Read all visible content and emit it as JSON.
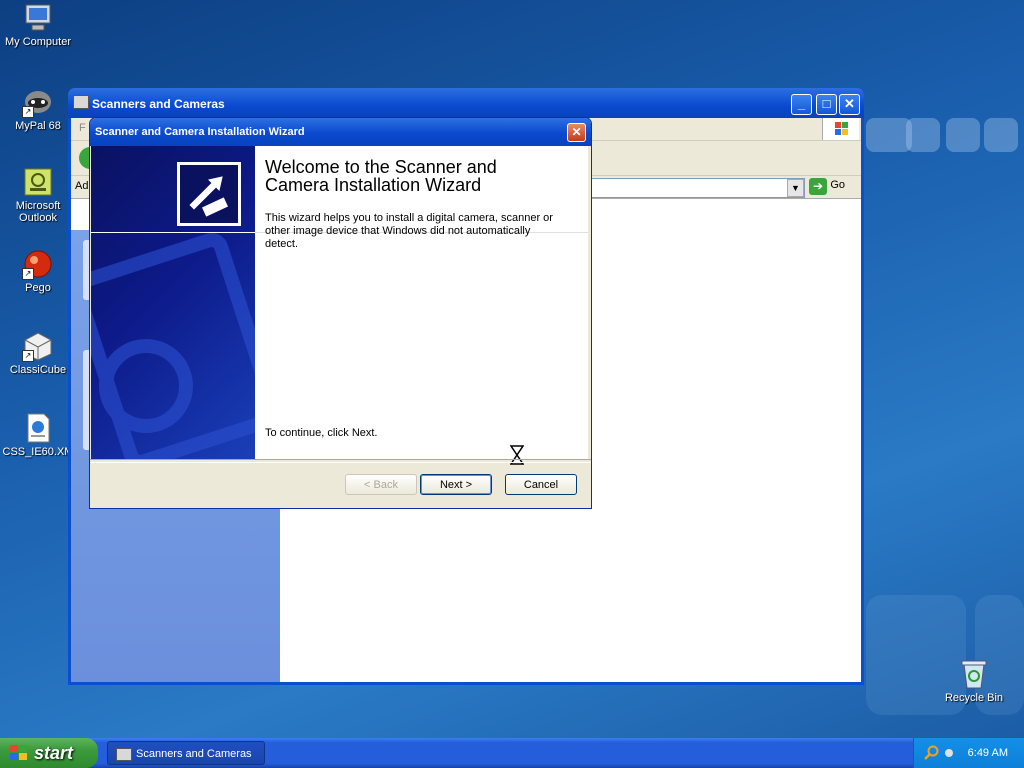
{
  "desktop": {
    "icons": [
      {
        "label": "My Computer"
      },
      {
        "label": "MyPal 68"
      },
      {
        "label": "Microsoft Outlook"
      },
      {
        "label": "Pego"
      },
      {
        "label": "ClassiCube"
      },
      {
        "label": "CSS_IE60.XM"
      },
      {
        "label": "Recycle Bin"
      }
    ]
  },
  "explorer": {
    "title": "Scanners and Cameras",
    "address_label": "Ad",
    "go_label": "Go",
    "menu_first": "F"
  },
  "wizard": {
    "title": "Scanner and Camera Installation Wizard",
    "heading": "Welcome to the Scanner and Camera Installation Wizard",
    "description": "This wizard helps you to install a digital camera, scanner or other image device that Windows did not automatically detect.",
    "continue_text": "To continue, click Next.",
    "back_label": "< Back",
    "next_label": "Next >",
    "cancel_label": "Cancel"
  },
  "taskbar": {
    "start_label": "start",
    "task_label": "Scanners and Cameras",
    "clock": "6:49 AM"
  }
}
